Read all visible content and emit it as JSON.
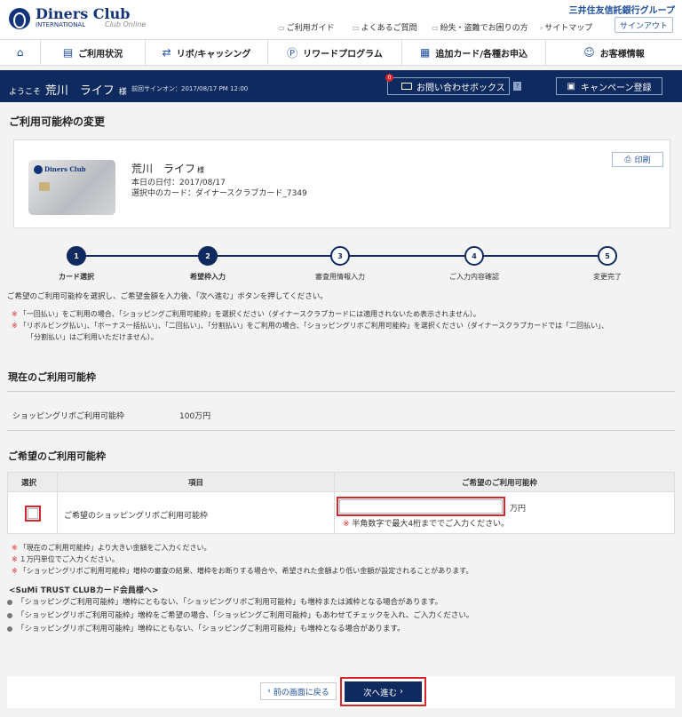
{
  "header": {
    "logo": "Diners Club",
    "logo_sub": "INTERNATIONAL",
    "logo_sub2": "Club Online",
    "group": "三井住友信託銀行グループ",
    "links": [
      "ご利用ガイド",
      "よくあるご質問",
      "紛失・盗難でお困りの方",
      "サイトマップ"
    ],
    "signout": "サインアウト"
  },
  "nav": {
    "items": [
      "ご利用状況",
      "リボ/キャッシング",
      "リワードプログラム",
      "追加カード/各種お申込",
      "お客様情報"
    ]
  },
  "welcome": {
    "prefix": "ようこそ",
    "name": "荒川　ライフ",
    "suffix": "様",
    "last_login": "前回サインオン：2017/08/17 PM 12:00",
    "inbox_label": "お問い合わせボックス",
    "inbox_badge": "0",
    "inbox_help": "?",
    "campaign": "キャンペーン登録"
  },
  "page_title": "ご利用可能枠の変更",
  "card": {
    "brand": "Diners Club",
    "name": "荒川　ライフ",
    "honorific": "様",
    "date": "本日の日付：2017/08/17",
    "selected": "選択中のカード：ダイナースクラブカード_7349",
    "print": "印刷"
  },
  "steps": [
    {
      "num": "1",
      "label": "カード選択"
    },
    {
      "num": "2",
      "label": "希望枠入力"
    },
    {
      "num": "3",
      "label": "審査用情報入力"
    },
    {
      "num": "4",
      "label": "ご入力内容確認"
    },
    {
      "num": "5",
      "label": "変更完了"
    }
  ],
  "instructions": "ご希望のご利用可能枠を選択し、ご希望金額を入力後、「次へ進む」ボタンを押してください。",
  "notes": [
    "「一回払い」をご利用の場合、「ショッピングご利用可能枠」を選択ください（ダイナースクラブカードには適用されないため表示されません）。",
    "「リボルビング払い」、「ボーナス一括払い」、「二回払い」、「分割払い」をご利用の場合、「ショッピングリボご利用可能枠」を選択ください（ダイナースクラブカードでは「二回払い」、",
    "「分割払い」はご利用いただけません）。"
  ],
  "current": {
    "title": "現在のご利用可能枠",
    "label": "ショッピングリボご利用可能枠",
    "value": "100万円"
  },
  "desired": {
    "title": "ご希望のご利用可能枠",
    "headers": [
      "選択",
      "項目",
      "ご希望のご利用可能枠"
    ],
    "row_label": "ご希望のショッピングリボご利用可能枠",
    "amount_value": "",
    "unit": "万円",
    "hint": "半角数字で最大4桁まででご入力ください。"
  },
  "desired_notes": [
    "「現在のご利用可能枠」より大きい金額をご入力ください。",
    "１万円単位でご入力ください。",
    "「ショッピングリボご利用可能枠」増枠の審査の結果、増枠をお断りする場合や、希望された金額より低い金額が設定されることがあります。"
  ],
  "members_title": "<SuMi TRUST CLUBカード会員様へ>",
  "member_bullets": [
    "「ショッピングご利用可能枠」増枠にともない、「ショッピングリボご利用可能枠」も増枠または減枠となる場合があります。",
    "「ショッピングリボご利用可能枠」増枠をご希望の場合、「ショッピングご利用可能枠」もあわせてチェックを入れ、ご入力ください。",
    "「ショッピングリボご利用可能枠」増枠にともない、「ショッピングご利用可能枠」も増枠となる場合があります。"
  ],
  "buttons": {
    "back": "前の画面に戻る",
    "next": "次へ進む"
  },
  "colors": {
    "navy": "#0e2a5e",
    "brand_blue": "#13347a",
    "highlight_red": "#d8262e"
  },
  "icons": {
    "home": "home-icon",
    "usage": "clipboard-icon",
    "revolving": "arrows-icon",
    "reward": "points-icon",
    "additional": "document-icon",
    "customer": "person-icon",
    "inbox": "envelope-icon",
    "campaign": "gift-icon",
    "print": "printer-icon"
  }
}
